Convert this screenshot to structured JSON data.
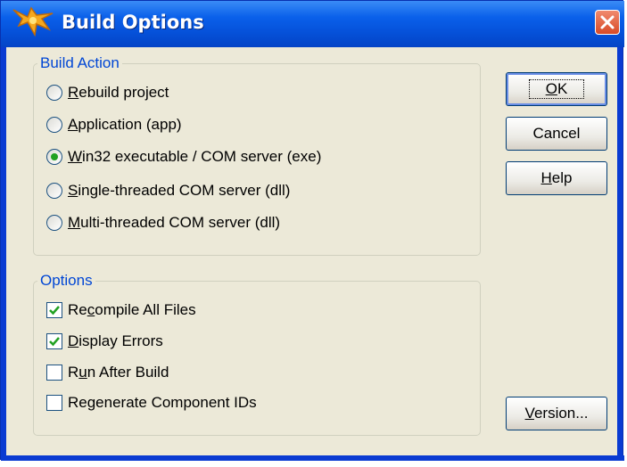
{
  "window": {
    "title": "Build Options"
  },
  "build_action": {
    "legend": "Build Action",
    "options": [
      {
        "pre": "",
        "key": "R",
        "post": "ebuild project",
        "checked": false
      },
      {
        "pre": "",
        "key": "A",
        "post": "pplication (app)",
        "checked": false
      },
      {
        "pre": "",
        "key": "W",
        "post": "in32 executable / COM server (exe)",
        "checked": true
      },
      {
        "pre": "",
        "key": "S",
        "post": "ingle-threaded COM server (dll)",
        "checked": false
      },
      {
        "pre": "",
        "key": "M",
        "post": "ulti-threaded COM server (dll)",
        "checked": false
      }
    ]
  },
  "options": {
    "legend": "Options",
    "items": [
      {
        "pre": "Re",
        "key": "c",
        "post": "ompile All Files",
        "checked": true
      },
      {
        "pre": "",
        "key": "D",
        "post": "isplay Errors",
        "checked": true
      },
      {
        "pre": "R",
        "key": "u",
        "post": "n After Build",
        "checked": false
      },
      {
        "pre": "Regenerate Component IDs",
        "key": "",
        "post": "",
        "checked": false
      }
    ]
  },
  "buttons": {
    "ok": {
      "pre": "",
      "key": "O",
      "post": "K"
    },
    "cancel": {
      "label": "Cancel"
    },
    "help": {
      "pre": "",
      "key": "H",
      "post": "elp"
    },
    "version": {
      "pre": "",
      "key": "V",
      "post": "ersion..."
    }
  },
  "colors": {
    "title_bar": "#0a60ea",
    "accent_legend": "#0046d5",
    "radio_dot": "#21a121",
    "check_mark": "#21a121",
    "close": "#d84a27"
  }
}
